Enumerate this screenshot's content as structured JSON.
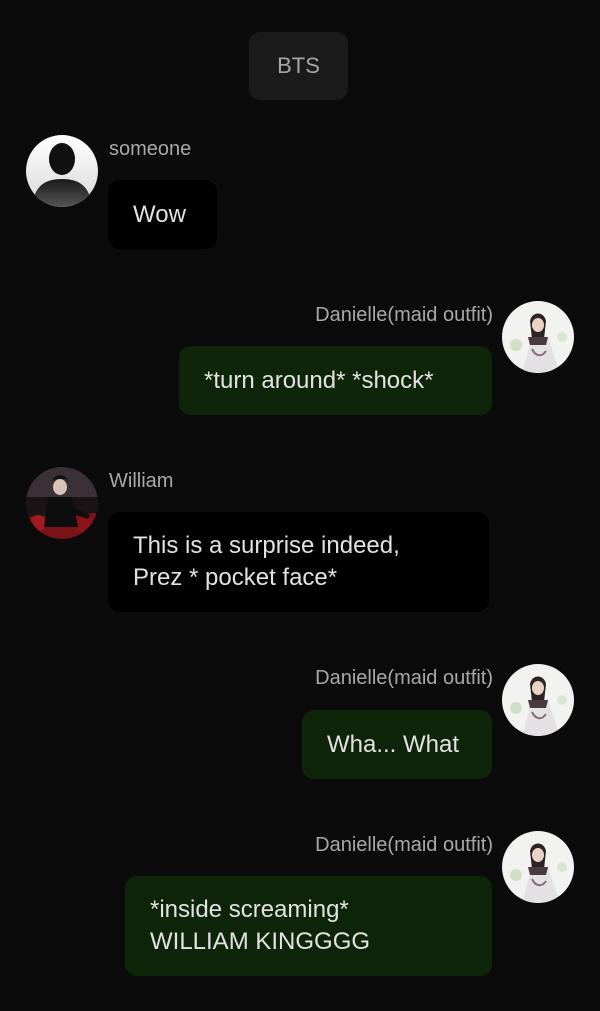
{
  "chat": {
    "title": "BTS"
  },
  "messages": [
    {
      "sender": "someone",
      "text": "Wow",
      "side": "left",
      "avatar": "silhouette-avatar"
    },
    {
      "sender": "Danielle(maid outfit)",
      "text": "*turn around* *shock*",
      "side": "right",
      "avatar": "maid-outfit-avatar"
    },
    {
      "sender": "William",
      "text": "This is a surprise indeed,\nPrez * pocket face*",
      "side": "left",
      "avatar": "william-avatar"
    },
    {
      "sender": "Danielle(maid outfit)",
      "text": "Wha... What",
      "side": "right",
      "avatar": "maid-outfit-avatar"
    },
    {
      "sender": "Danielle(maid outfit)",
      "text": "*inside screaming*\nWILLIAM KINGGGG",
      "side": "right",
      "avatar": "maid-outfit-avatar"
    }
  ],
  "colors": {
    "background": "#0b0b0b",
    "incoming_bubble": "#000000",
    "outgoing_bubble": "#0f2509",
    "text": "#e2e2e2",
    "name_text": "#a8a8a8"
  }
}
